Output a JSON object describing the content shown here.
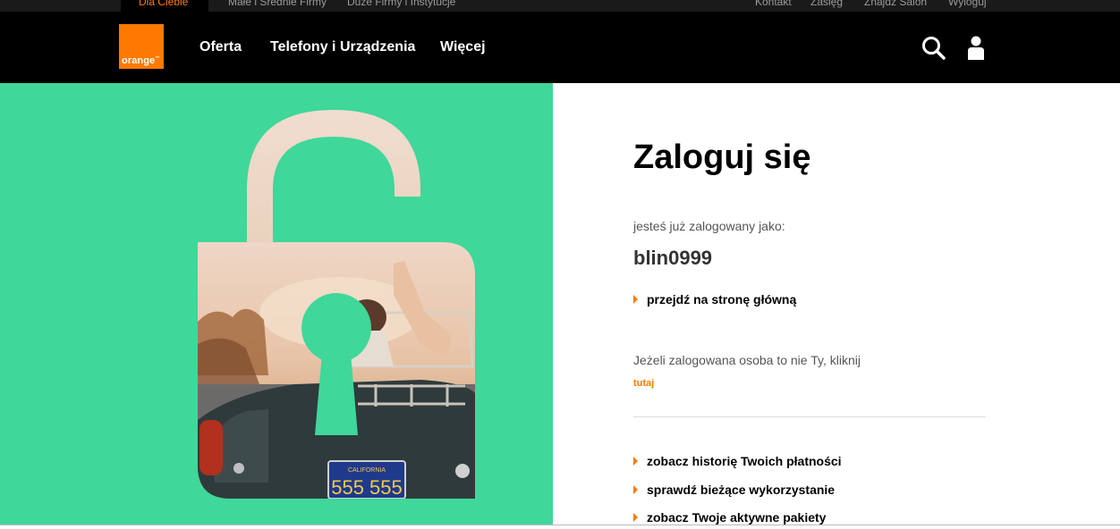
{
  "topbar": {
    "left": [
      "Dla Ciebie",
      "Małe i Średnie Firmy",
      "Duże Firmy i Instytucje"
    ],
    "right": [
      "Kontakt",
      "Zasięg",
      "Znajdź Salon",
      "Wyloguj"
    ]
  },
  "header": {
    "logo_text": "orange",
    "logo_tm": "™",
    "nav": [
      "Oferta",
      "Telefony i Urządzenia",
      "Więcej"
    ],
    "icons": [
      "search-icon",
      "user-icon"
    ]
  },
  "colors": {
    "brand": "#ff7900",
    "accent": "#3fd79a",
    "header": "#000000"
  },
  "main": {
    "title": "Zaloguj się",
    "logged_as_label": "jesteś już zalogowany jako:",
    "username": "blin0999",
    "home_link": "przejdź na stronę główną",
    "not_you_text": "Jeżeli zalogowana osoba to nie Ty, kliknij",
    "not_you_link": "tutaj",
    "links": [
      "zobacz historię Twoich płatności",
      "sprawdź bieżące wykorzystanie",
      "zobacz Twoje aktywne pakiety"
    ]
  },
  "illustration": {
    "plate_state": "CALIFORNIA",
    "plate_number": "555 555"
  }
}
